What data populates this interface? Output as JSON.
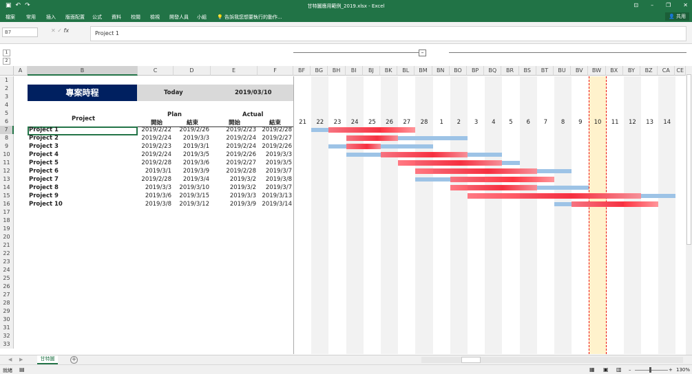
{
  "app": {
    "title": "甘特圖應用範例_2019.xlsx - Excel"
  },
  "ribbon": {
    "tabs": [
      "檔案",
      "常用",
      "插入",
      "版面配置",
      "公式",
      "資料",
      "校閱",
      "檢視",
      "開發人員",
      "小組"
    ],
    "tell": "告訴我您想要執行的動作...",
    "share": "共用"
  },
  "formula": {
    "namebox": "B7",
    "content": "Project 1"
  },
  "outline": [
    "1",
    "2"
  ],
  "grid": {
    "col_letters": [
      "A",
      "B",
      "C",
      "D",
      "E",
      "F"
    ],
    "gantt_cols": [
      "BF",
      "BG",
      "BH",
      "BI",
      "BJ",
      "BK",
      "BL",
      "BM",
      "BN",
      "BO",
      "BP",
      "BQ",
      "BR",
      "BS",
      "BT",
      "BU",
      "BV",
      "BW",
      "BX",
      "BY",
      "BZ",
      "CA",
      "CE"
    ],
    "day_numbers": [
      "21",
      "22",
      "23",
      "24",
      "25",
      "26",
      "27",
      "28",
      "1",
      "2",
      "3",
      "4",
      "5",
      "6",
      "7",
      "8",
      "9",
      "10",
      "11",
      "12",
      "13",
      "14"
    ],
    "row_numbers": [
      "1",
      "2",
      "3",
      "4",
      "5",
      "6",
      "7",
      "8",
      "9",
      "10",
      "11",
      "12",
      "13",
      "14",
      "15",
      "16",
      "17",
      "18",
      "19",
      "20",
      "21",
      "22",
      "23",
      "24",
      "25",
      "26",
      "27",
      "28",
      "29",
      "30",
      "31",
      "32",
      "33"
    ]
  },
  "header": {
    "title": "專案時程",
    "today_label": "Today",
    "today_value": "2019/03/10",
    "project": "Project",
    "plan": "Plan",
    "actual": "Actual",
    "start": "開始",
    "end": "結束"
  },
  "projects": [
    {
      "name": "Project 1",
      "plan_start": "2019/2/22",
      "plan_end": "2019/2/26",
      "act_start": "2019/2/23",
      "act_end": "2019/2/28"
    },
    {
      "name": "Project 2",
      "plan_start": "2019/2/24",
      "plan_end": "2019/3/3",
      "act_start": "2019/2/24",
      "act_end": "2019/2/27"
    },
    {
      "name": "Project 3",
      "plan_start": "2019/2/23",
      "plan_end": "2019/3/1",
      "act_start": "2019/2/24",
      "act_end": "2019/2/26"
    },
    {
      "name": "Project 4",
      "plan_start": "2019/2/24",
      "plan_end": "2019/3/5",
      "act_start": "2019/2/26",
      "act_end": "2019/3/3"
    },
    {
      "name": "Project 5",
      "plan_start": "2019/2/28",
      "plan_end": "2019/3/6",
      "act_start": "2019/2/27",
      "act_end": "2019/3/5"
    },
    {
      "name": "Project 6",
      "plan_start": "2019/3/1",
      "plan_end": "2019/3/9",
      "act_start": "2019/2/28",
      "act_end": "2019/3/7"
    },
    {
      "name": "Project 7",
      "plan_start": "2019/2/28",
      "plan_end": "2019/3/4",
      "act_start": "2019/3/2",
      "act_end": "2019/3/8"
    },
    {
      "name": "Project 8",
      "plan_start": "2019/3/3",
      "plan_end": "2019/3/10",
      "act_start": "2019/3/2",
      "act_end": "2019/3/7"
    },
    {
      "name": "Project 9",
      "plan_start": "2019/3/6",
      "plan_end": "2019/3/15",
      "act_start": "2019/3/3",
      "act_end": "2019/3/13"
    },
    {
      "name": "Project 10",
      "plan_start": "2019/3/8",
      "plan_end": "2019/3/12",
      "act_start": "2019/3/9",
      "act_end": "2019/3/14"
    }
  ],
  "sheet": {
    "tab": "甘特圖",
    "add": "+"
  },
  "status": {
    "ready": "就緒",
    "zoom": "130%"
  },
  "colors": {
    "accent": "#217346",
    "title_bg": "#002060",
    "plan_bar": "#9dc3e6",
    "actual_bar": "#ff0000",
    "today": "#fff2cc",
    "weekend": "#f2f2f2"
  }
}
